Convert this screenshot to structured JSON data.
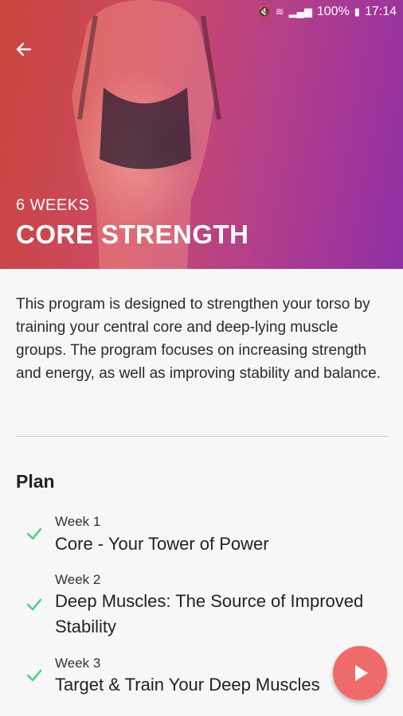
{
  "statusbar": {
    "battery": "100%",
    "time": "17:14"
  },
  "hero": {
    "duration": "6 WEEKS",
    "title": "CORE STRENGTH"
  },
  "description": "This program is designed to strengthen your torso by training your central core and deep-lying muscle groups. The program focuses on increasing strength and energy, as well as improving stability and balance.",
  "plan": {
    "title": "Plan",
    "weeks": [
      {
        "week": "Week 1",
        "name": "Core - Your Tower of Power"
      },
      {
        "week": "Week 2",
        "name": "Deep Muscles: The Source of Improved Stability"
      },
      {
        "week": "Week 3",
        "name": "Target & Train Your Deep Muscles"
      }
    ]
  },
  "colors": {
    "accent": "#ef6b6b",
    "check": "#4cd386"
  }
}
